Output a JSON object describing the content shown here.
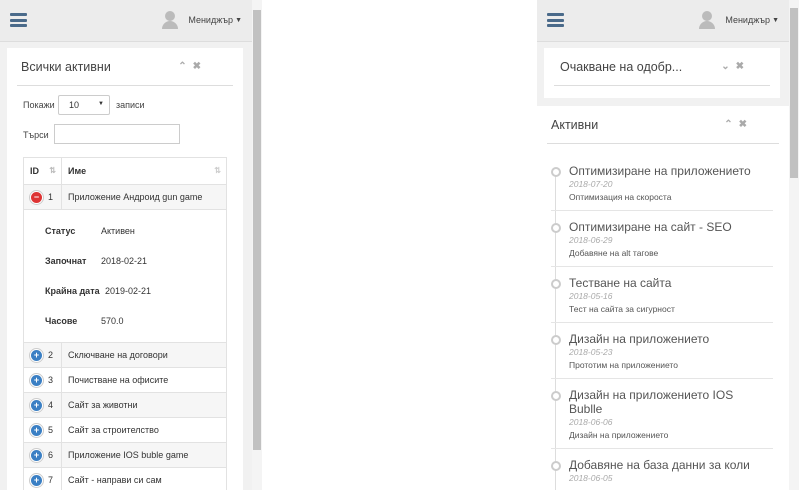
{
  "left": {
    "user_label": "Мениджър",
    "panel_title": "Всички активни",
    "show_label": "Покажи",
    "page_size": "10",
    "records_label": "записи",
    "search_label": "Търси",
    "columns": [
      "ID",
      "Име"
    ],
    "expanded_row": {
      "id": "1",
      "name": "Приложение Андроид gun game",
      "details": [
        {
          "label": "Статус",
          "value": "Активен"
        },
        {
          "label": "Започнат",
          "value": "2018-02-21"
        },
        {
          "label": "Крайна дата",
          "value": "2019-02-21"
        },
        {
          "label": "Часове",
          "value": "570.0"
        }
      ]
    },
    "rows": [
      {
        "id": "2",
        "name": "Сключване на договори"
      },
      {
        "id": "3",
        "name": "Почистване на офисите"
      },
      {
        "id": "4",
        "name": "Сайт за животни"
      },
      {
        "id": "5",
        "name": "Сайт за строителство"
      },
      {
        "id": "6",
        "name": "Приложение IOS buble game"
      },
      {
        "id": "7",
        "name": "Сайт - направи си сам"
      }
    ]
  },
  "right": {
    "user_label": "Мениджър",
    "pending_title": "Очакване на одобр...",
    "active_title": "Активни",
    "timeline": [
      {
        "title": "Оптимизиране на приложението",
        "date": "2018-07-20",
        "desc": "Оптимизация на скороста"
      },
      {
        "title": "Оптимизиране на сайт - SEO",
        "date": "2018-06-29",
        "desc": "Добавяне на alt тагове"
      },
      {
        "title": "Тестване на сайта",
        "date": "2018-05-16",
        "desc": "Тест на сайта за сигурност"
      },
      {
        "title": "Дизайн на приложението",
        "date": "2018-05-23",
        "desc": "Прототим на приложението"
      },
      {
        "title": "Дизайн на приложението IOS Bublle",
        "date": "2018-06-06",
        "desc": "Дизайн на приложението"
      },
      {
        "title": "Добавяне на база данни за коли",
        "date": "2018-06-05",
        "desc": ""
      }
    ]
  }
}
